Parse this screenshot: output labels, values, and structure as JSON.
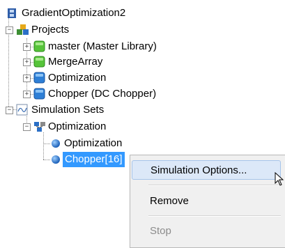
{
  "tree": {
    "root": "GradientOptimization2",
    "projects": {
      "label": "Projects",
      "items": [
        "master (Master Library)",
        "MergeArray",
        "Optimization",
        "Chopper (DC Chopper)"
      ]
    },
    "simulation_sets": {
      "label": "Simulation Sets",
      "group": "Optimization",
      "items": [
        "Optimization",
        "Chopper[16]"
      ]
    }
  },
  "context_menu": {
    "items": [
      "Simulation Options...",
      "Remove",
      "Stop"
    ]
  },
  "colors": {
    "selection": "#3399ff",
    "menu_background": "#f0f0f0",
    "menu_hover": "#dce8f8"
  }
}
